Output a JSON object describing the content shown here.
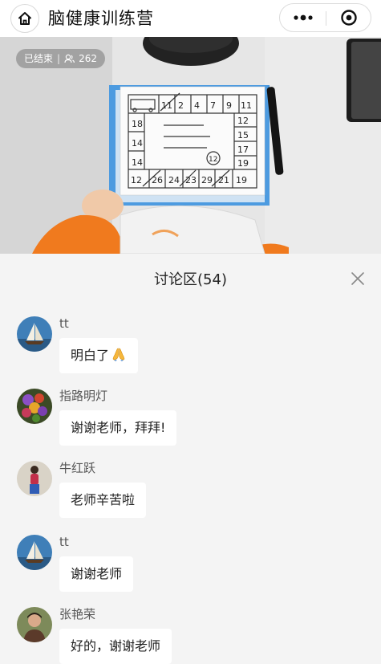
{
  "header": {
    "title": "脑健康训练营",
    "home_icon": "home-icon",
    "more_icon": "more-dots-icon",
    "close_icon": "miniprogram-close-icon"
  },
  "video": {
    "status": "已结束",
    "separator": "|",
    "viewer_icon": "viewers-icon",
    "viewer_count": "262",
    "board": {
      "top_row": [
        "11",
        "2",
        "4",
        "7",
        "9",
        "11"
      ],
      "right_col": [
        "12",
        "15",
        "17",
        "19",
        "19"
      ],
      "bottom_row": [
        "12",
        "26",
        "24",
        "23",
        "29",
        "21"
      ],
      "left_col": [
        "18",
        "14",
        "14"
      ],
      "circled": "12"
    }
  },
  "discussion": {
    "title": "讨论区(54)",
    "close_icon": "close-icon",
    "messages": [
      {
        "nick": "tt",
        "text": "明白了",
        "emoji": "pray-emoji"
      },
      {
        "nick": "指路明灯",
        "text": "谢谢老师，拜拜!"
      },
      {
        "nick": "牛红跃",
        "text": "老师辛苦啦"
      },
      {
        "nick": "tt",
        "text": "谢谢老师"
      },
      {
        "nick": "张艳荣",
        "text": "好的，谢谢老师"
      }
    ]
  },
  "colors": {
    "accent_orange": "#f07a1e",
    "badge_bg": "#7a7a7a",
    "panel_bg": "#f4f4f4"
  }
}
